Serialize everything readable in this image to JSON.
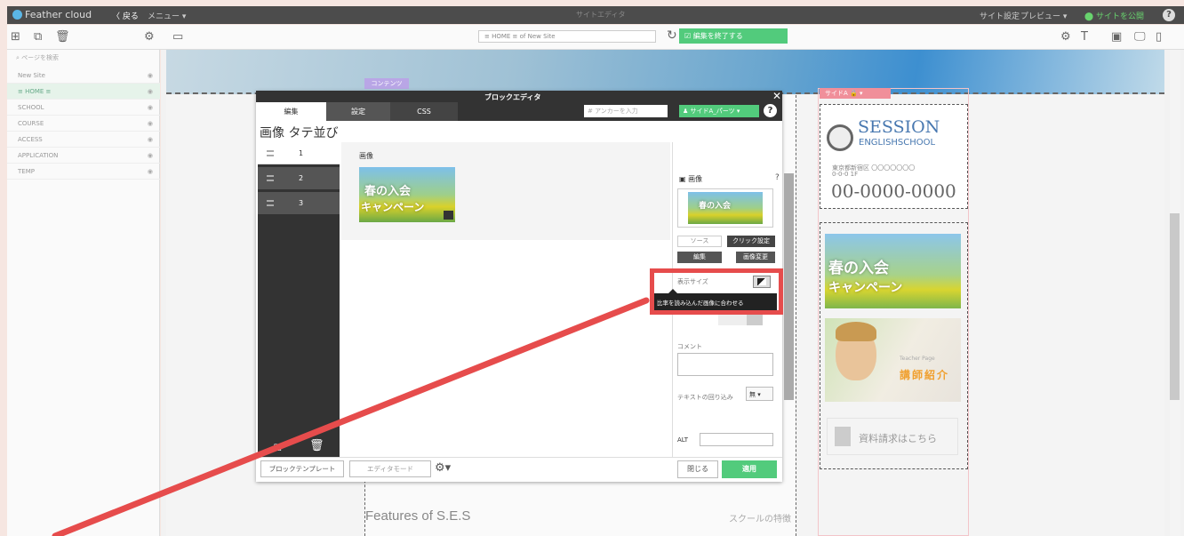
{
  "topbar": {
    "app_name": "Feather cloud",
    "back": "〈 戻る",
    "menu": "メニュー ▾",
    "center_title": "サイトエディタ",
    "site_settings": "サイト設定",
    "preview": "プレビュー ▾",
    "publish": "サイトを公開"
  },
  "toolbar": {
    "url": "≡ HOME ≡ of New Site",
    "finish_label": "編集を終了する"
  },
  "sidebar": {
    "search_placeholder": "ページを検索",
    "items": [
      {
        "label": "New Site"
      },
      {
        "label": "≡ HOME ≡"
      },
      {
        "label": "SCHOOL"
      },
      {
        "label": "COURSE"
      },
      {
        "label": "ACCESS"
      },
      {
        "label": "APPLICATION"
      },
      {
        "label": "TEMP"
      }
    ]
  },
  "canvas": {
    "content_tag": "コンテンツ",
    "features": "Features of S.E.S",
    "school_features": "スクールの特徴",
    "side_tag": "サイドA",
    "logo_session": "SESSION",
    "logo_english": "ENGLISHSCHOOL",
    "logo_small1": "東京都新宿区 〇〇〇〇〇〇〇",
    "logo_small2": "0-0-0 1F",
    "phone": "00-0000-0000",
    "teacher_label": "講師紹介",
    "teacher_sub": "Teacher Page",
    "request": "資料請求はこちら",
    "banner_l1": "春の入会",
    "banner_l2": "キャンペーン"
  },
  "editor": {
    "title": "ブロックエディタ",
    "tabs": [
      "編集",
      "設定",
      "CSS"
    ],
    "anchor_placeholder": "# アンカーを入力",
    "side_a": "サイドA_パーツ ▾",
    "block_title": "画像 タテ並び",
    "blocks": [
      "1",
      "2",
      "3"
    ],
    "image_label": "画像",
    "props": {
      "image": "画像",
      "source": "ソース",
      "click_settings": "クリック設定",
      "edit": "編集",
      "change_image": "画像変更",
      "display_size": "表示サイズ",
      "tooltip": "比率を読み込んだ画像に合わせる",
      "comment": "コメント",
      "wrap": "テキストの回り込み",
      "wrap_value": "無 ▾",
      "alt": "ALT"
    },
    "template_btn": "ブロックテンプレート",
    "mode_btn": "エディタモード",
    "close_btn": "閉じる",
    "apply_btn": "適用"
  },
  "colors": {
    "accent_green": "#52cb7c",
    "highlight_red": "#e64c4c",
    "dark": "#333333"
  }
}
